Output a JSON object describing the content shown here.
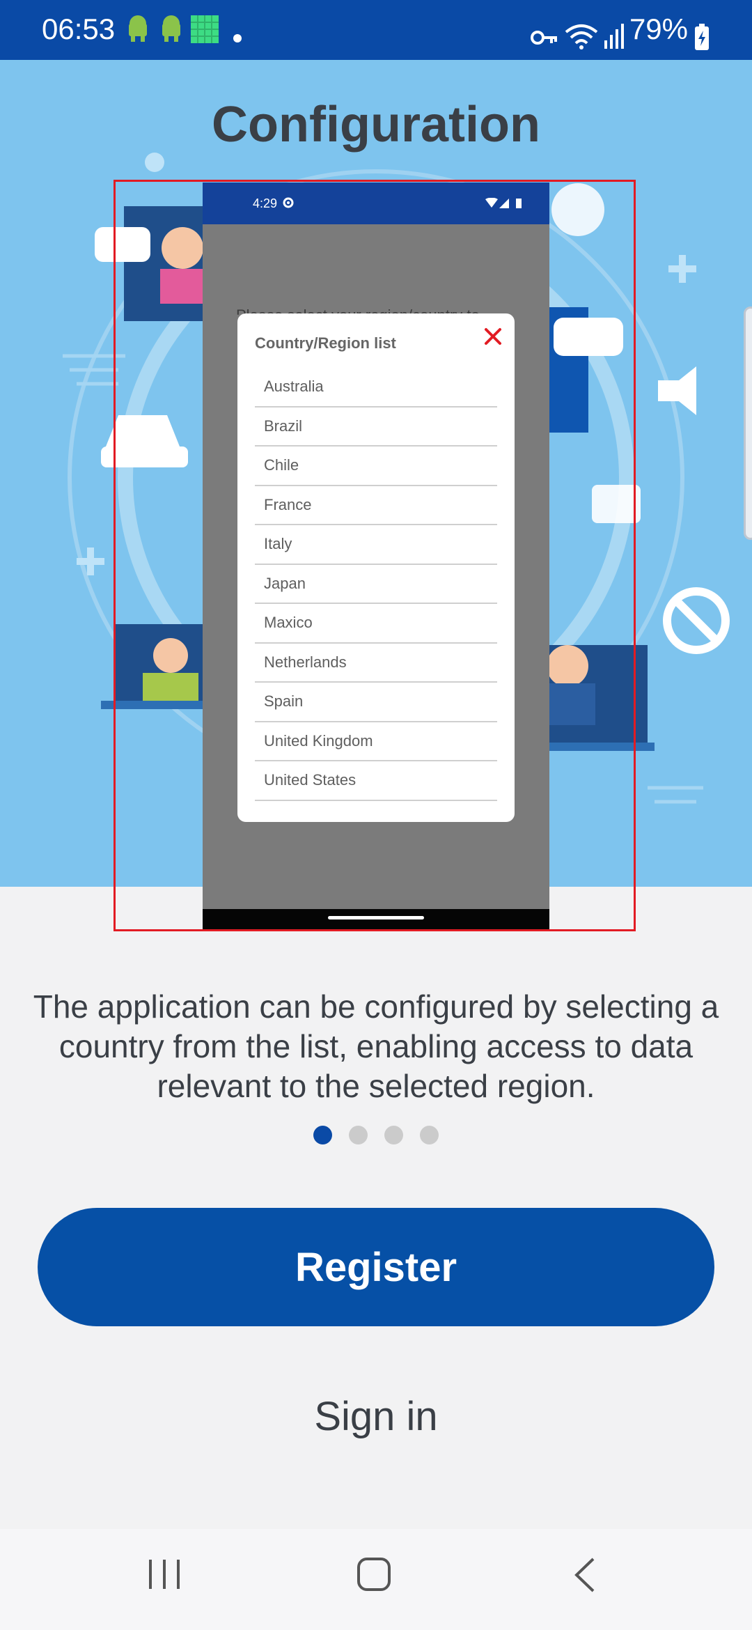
{
  "status_bar": {
    "time": "06:53",
    "battery": "79%",
    "icons": [
      "android-icon",
      "android-icon",
      "grid-app-icon",
      "dot-icon",
      "key-icon",
      "wifi-icon",
      "signal-icon",
      "battery-charging-icon"
    ]
  },
  "page": {
    "title": "Configuration",
    "description": "The application can be configured by selecting a country from the list, enabling access to data relevant to the selected region."
  },
  "preview": {
    "mini_time": "4:29",
    "background_text": "Please select your region/country to",
    "dialog": {
      "title": "Country/Region list",
      "countries": [
        "Australia",
        "Brazil",
        "Chile",
        "France",
        "Italy",
        "Japan",
        "Maxico",
        "Netherlands",
        "Spain",
        "United Kingdom",
        "United States"
      ]
    }
  },
  "pager": {
    "count": 4,
    "active_index": 0
  },
  "actions": {
    "register_label": "Register",
    "signin_label": "Sign in"
  },
  "colors": {
    "brand_blue": "#0650a6",
    "highlight_red": "#e21b23",
    "hero_blue": "#7ec4ee"
  }
}
